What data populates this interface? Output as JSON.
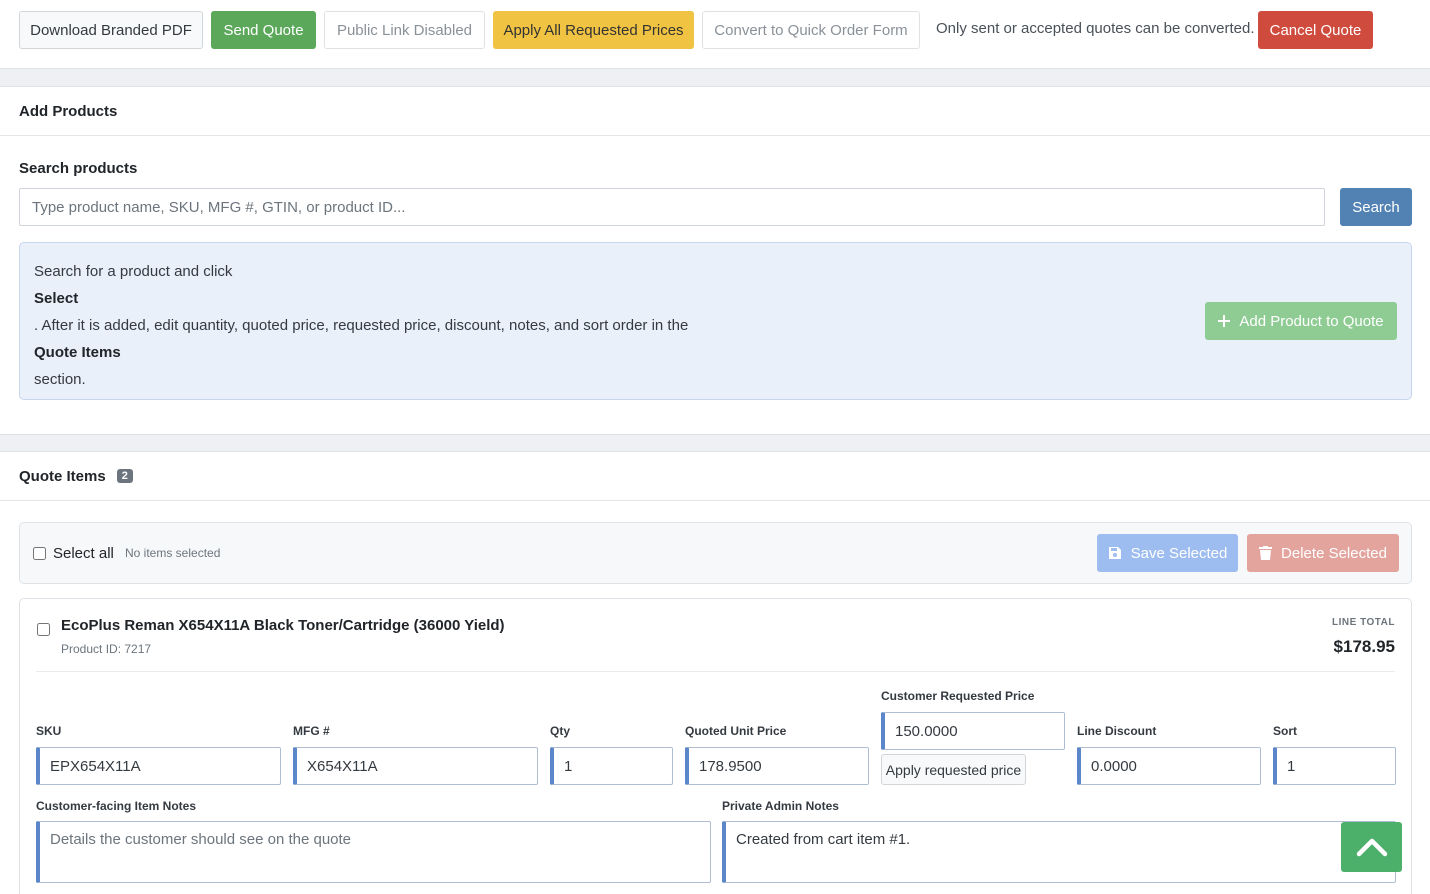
{
  "toolbar": {
    "download_pdf": "Download Branded PDF",
    "send_quote": "Send Quote",
    "public_link": "Public Link Disabled",
    "apply_all": "Apply All Requested Prices",
    "convert": "Convert to Quick Order Form",
    "convert_note": "Only sent or accepted quotes can be converted.",
    "cancel_quote": "Cancel Quote"
  },
  "add_products": {
    "title": "Add Products",
    "search_label": "Search products",
    "search_placeholder": "Type product name, SKU, MFG #, GTIN, or product ID...",
    "search_button": "Search",
    "info_lines": [
      "Search for a product and click",
      "Select",
      ". After it is added, edit quantity, quoted price, requested price, discount, notes, and sort order in the",
      "Quote Items",
      "section."
    ],
    "add_button": "Add Product to Quote"
  },
  "quote_items": {
    "title": "Quote Items",
    "count": "2",
    "select_all_label": "Select all",
    "selection_status": "No items selected",
    "save_selected": "Save Selected",
    "delete_selected": "Delete Selected",
    "items": [
      {
        "name": "EcoPlus Reman X654X11A Black Toner/Cartridge (36000 Yield)",
        "product_id": "Product ID: 7217",
        "line_total_label": "LINE TOTAL",
        "line_total": "$178.95",
        "sku_label": "SKU",
        "sku": "EPX654X11A",
        "mfg_label": "MFG #",
        "mfg": "X654X11A",
        "qty_label": "Qty",
        "qty": "1",
        "quoted_label": "Quoted Unit Price",
        "quoted": "178.9500",
        "requested_label": "Customer Requested Price",
        "requested": "150.0000",
        "apply_requested": "Apply requested price",
        "discount_label": "Line Discount",
        "discount": "0.0000",
        "sort_label": "Sort",
        "sort": "1",
        "customer_notes_label": "Customer-facing Item Notes",
        "customer_notes_placeholder": "Details the customer should see on the quote",
        "admin_notes_label": "Private Admin Notes",
        "admin_notes": "Created from cart item #1."
      }
    ]
  },
  "icons": {
    "plus": "plus-icon",
    "save": "floppy-disk-icon",
    "trash": "trash-icon",
    "scroll_top": "chevron-up-icon"
  },
  "colors": {
    "send": "#5ba85b",
    "apply": "#f0c342",
    "cancel": "#cf4b3d",
    "search": "#5282b4",
    "field_accent": "#5b86c9"
  }
}
